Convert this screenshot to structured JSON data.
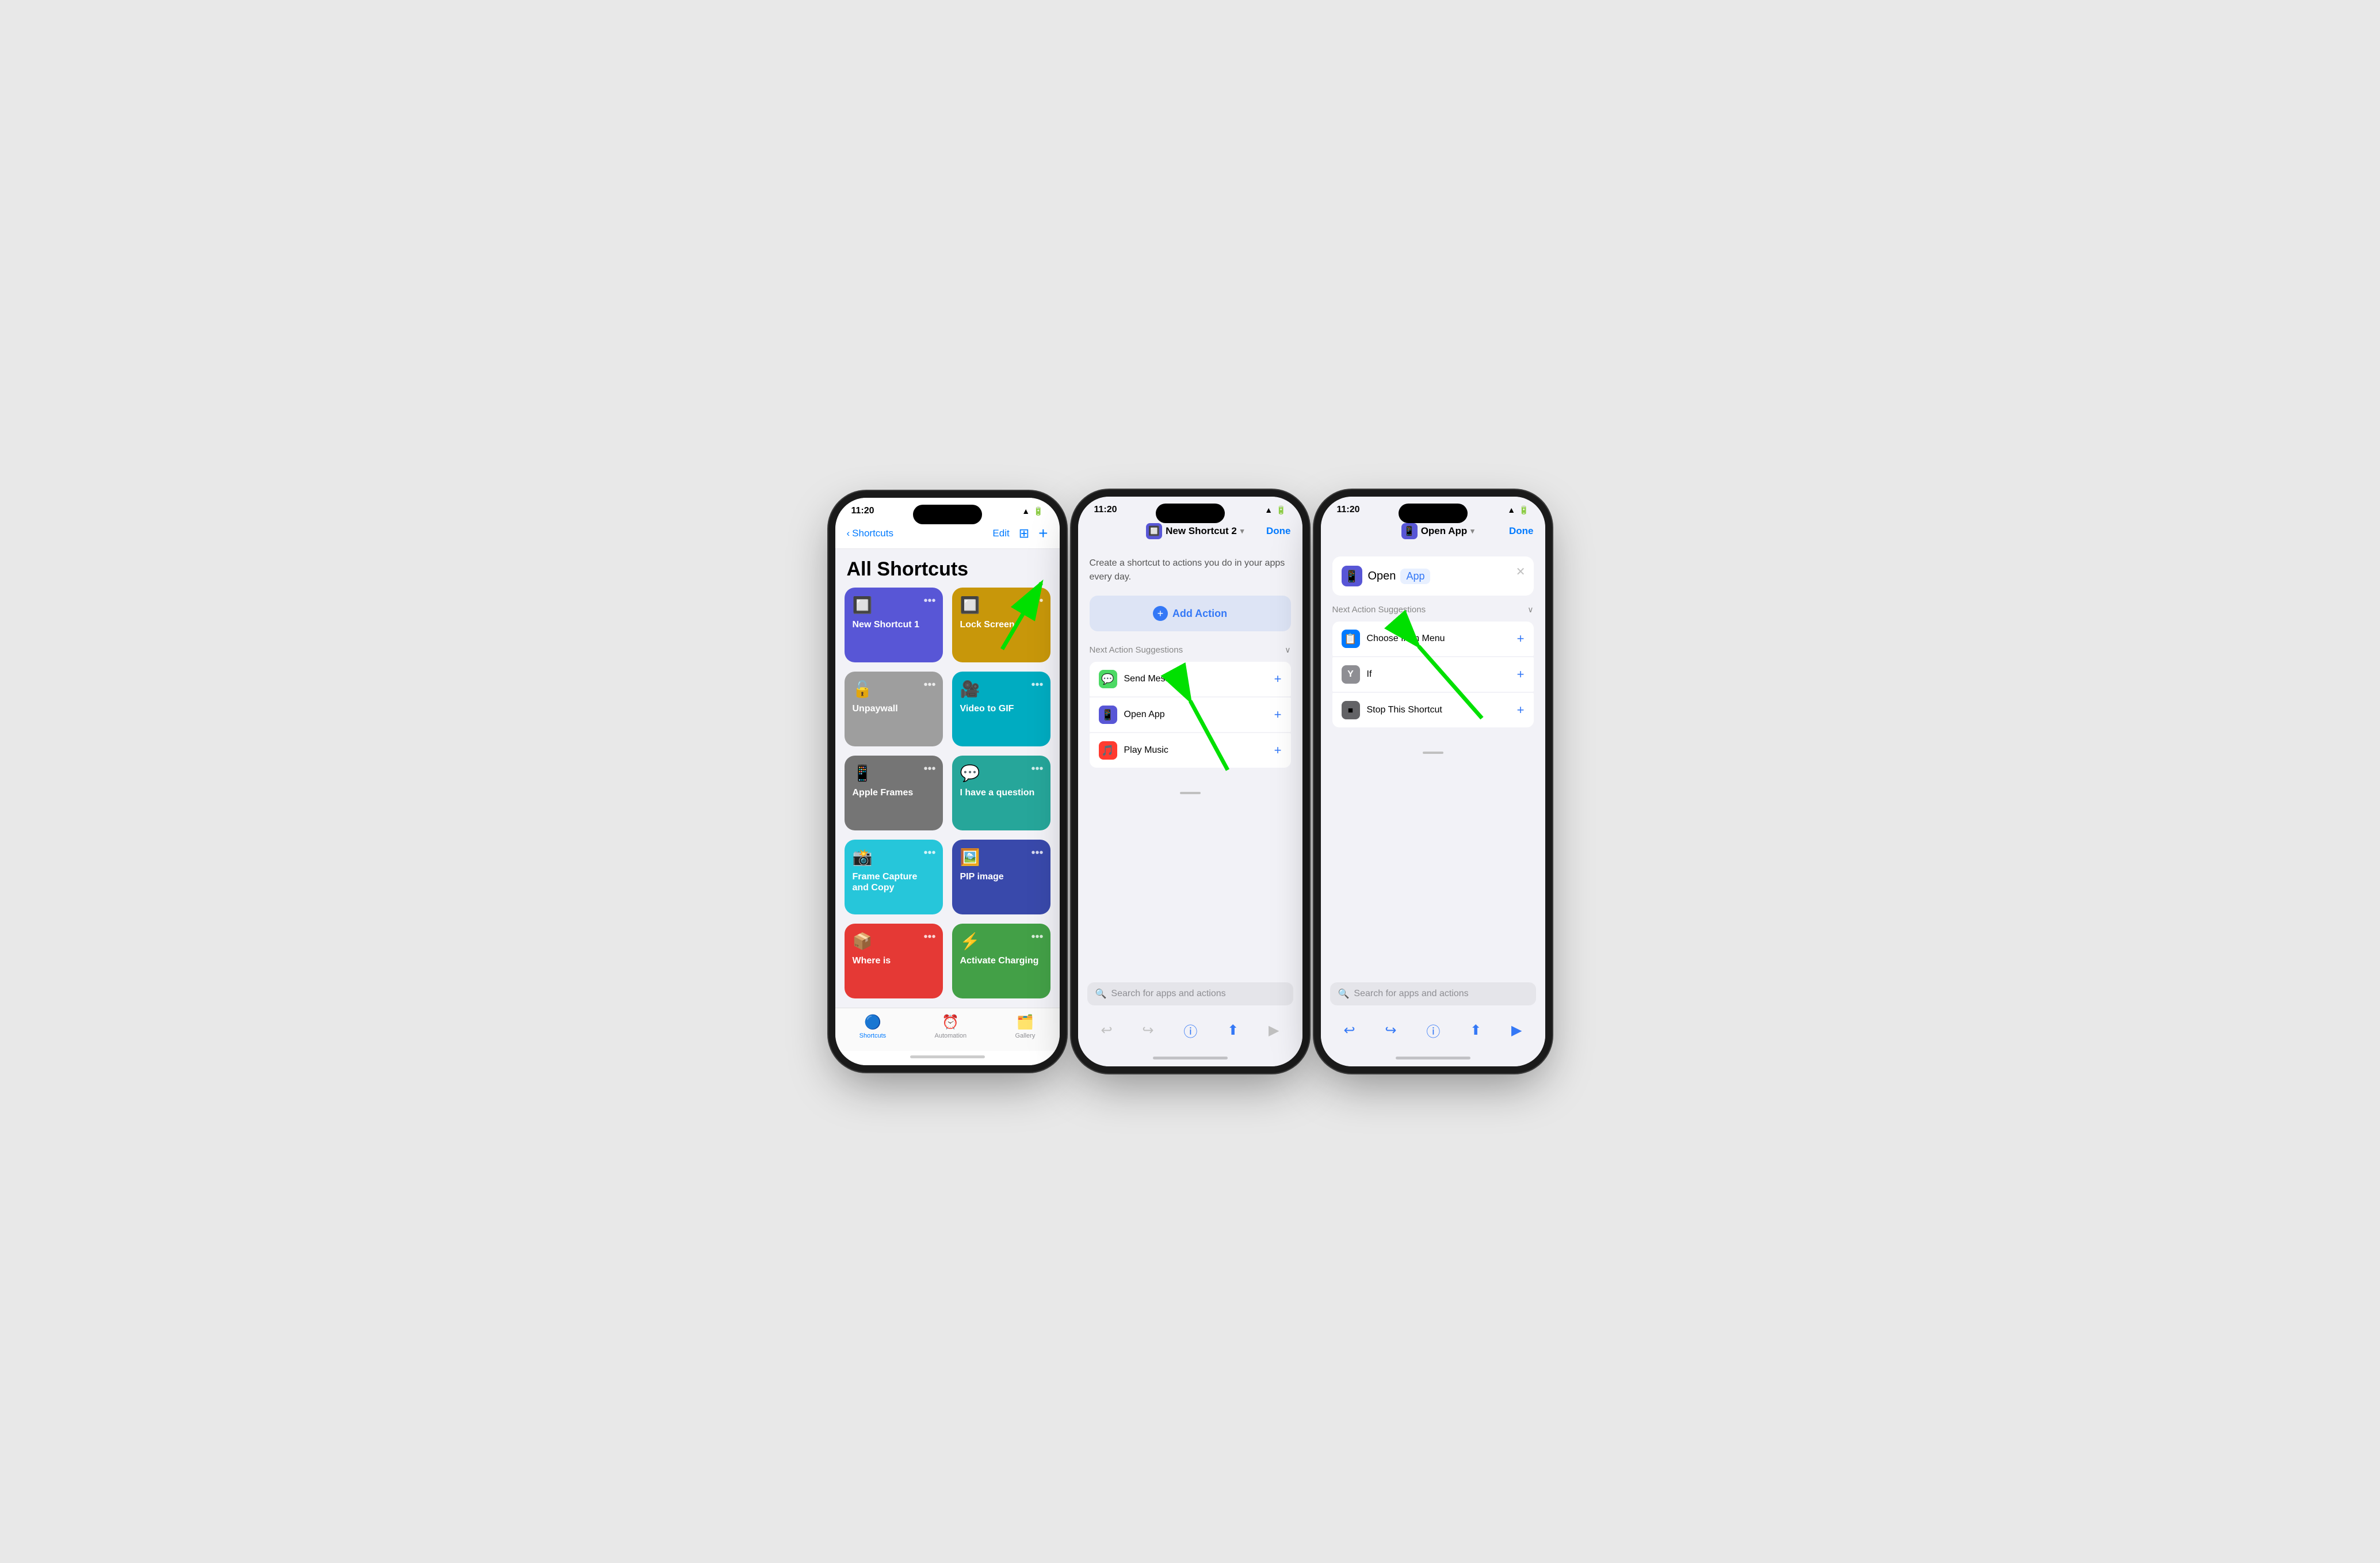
{
  "colors": {
    "blue": "#007aff",
    "accent": "#3478f6",
    "green": "#00c853",
    "yellow": "#f5a623",
    "teal": "#00bfa5",
    "purple_dark": "#3949ab",
    "cyan": "#00acc1",
    "teal2": "#26a69a",
    "gray_tile": "#8e8e93",
    "red": "#e53935"
  },
  "status_bar": {
    "time": "11:20",
    "wifi": "100",
    "battery": "100"
  },
  "phone1": {
    "nav": {
      "back_label": "Shortcuts",
      "edit_label": "Edit",
      "title": "All Shortcuts"
    },
    "tiles": [
      {
        "name": "New Shortcut 1",
        "bg": "#5856d6",
        "icon": "1️⃣",
        "has_more": true
      },
      {
        "name": "Lock Screen",
        "bg": "#d4a017",
        "icon": "🔲",
        "has_more": true
      },
      {
        "name": "Unpaywall",
        "bg": "#9e9e9e",
        "icon": "🔓",
        "has_more": true
      },
      {
        "name": "Video to GIF",
        "bg": "#00acc1",
        "icon": "🎥",
        "has_more": true
      },
      {
        "name": "Apple Frames",
        "bg": "#757575",
        "icon": "📱",
        "has_more": true
      },
      {
        "name": "I have a question",
        "bg": "#26a69a",
        "icon": "💬",
        "has_more": true
      },
      {
        "name": "Frame Capture and Copy",
        "bg": "#26c6da",
        "icon": "📸",
        "has_more": true
      },
      {
        "name": "PIP image",
        "bg": "#3949ab",
        "icon": "🖼️",
        "has_more": true
      },
      {
        "name": "Where is",
        "bg": "#e53935",
        "icon": "📦",
        "has_more": true
      },
      {
        "name": "Activate Charging",
        "bg": "#43a047",
        "icon": "⚡",
        "has_more": true
      }
    ],
    "tabs": [
      {
        "label": "Shortcuts",
        "icon": "🔵",
        "active": true
      },
      {
        "label": "Automation",
        "icon": "⚙️",
        "active": false
      },
      {
        "label": "Gallery",
        "icon": "📋",
        "active": false
      }
    ]
  },
  "phone2": {
    "nav": {
      "title": "New Shortcut 2",
      "done_label": "Done"
    },
    "description": "Create a shortcut to actions you do in your apps every day.",
    "add_action_label": "Add Action",
    "suggestions_title": "Next Action Suggestions",
    "suggestions": [
      {
        "name": "Send Message",
        "icon": "💬",
        "icon_bg": "#4cd964"
      },
      {
        "name": "Open App",
        "icon": "📱",
        "icon_bg": "#5856d6"
      },
      {
        "name": "Play Music",
        "icon": "🎵",
        "icon_bg": "#ff3b30"
      }
    ],
    "search_placeholder": "Search for apps and actions"
  },
  "phone3": {
    "nav": {
      "title": "Open App",
      "done_label": "Done"
    },
    "action": {
      "open_label": "Open",
      "app_label": "App"
    },
    "suggestions_title": "Next Action Suggestions",
    "suggestions": [
      {
        "name": "Choose from Menu",
        "icon": "📋",
        "icon_bg": "#007aff"
      },
      {
        "name": "If",
        "icon": "Y",
        "icon_bg": "#8e8e93"
      },
      {
        "name": "Stop This Shortcut",
        "icon": "⏹",
        "icon_bg": "#636366"
      }
    ],
    "search_placeholder": "Search for apps and actions"
  }
}
